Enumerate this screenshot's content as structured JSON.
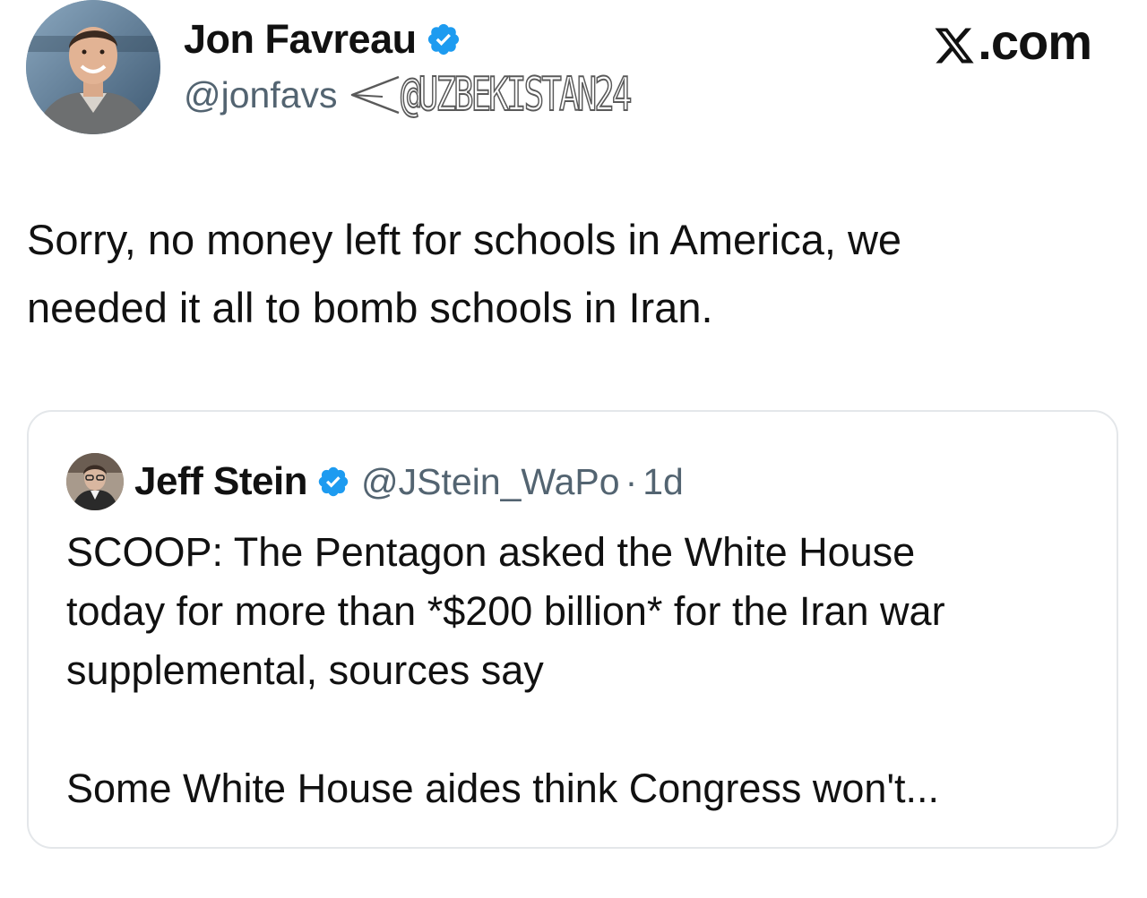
{
  "header": {
    "author_name": "Jon Favreau",
    "author_handle": "@jonfavs",
    "site_label": ".com",
    "watermark": "@UZBEKISTAN24"
  },
  "tweet": {
    "text": "Sorry, no money left for schools in America, we\nneeded it all to bomb schools in Iran."
  },
  "quote": {
    "author_name": "Jeff Stein",
    "author_handle": "@JStein_WaPo",
    "separator": "·",
    "time": "1d",
    "text_lines": [
      "SCOOP: The Pentagon asked the White House",
      "today for more than *$200 billion* for the Iran war",
      "supplemental, sources say"
    ],
    "text_continued": "Some White House aides think Congress won't..."
  },
  "icons": {
    "verified": "verified-badge-icon",
    "x_logo": "x-logo-icon",
    "watermark_arrow": "paper-plane-outline-icon"
  },
  "colors": {
    "verified_blue": "#1d9bf0",
    "secondary_text": "#536471",
    "card_border": "#e4e7ea"
  }
}
